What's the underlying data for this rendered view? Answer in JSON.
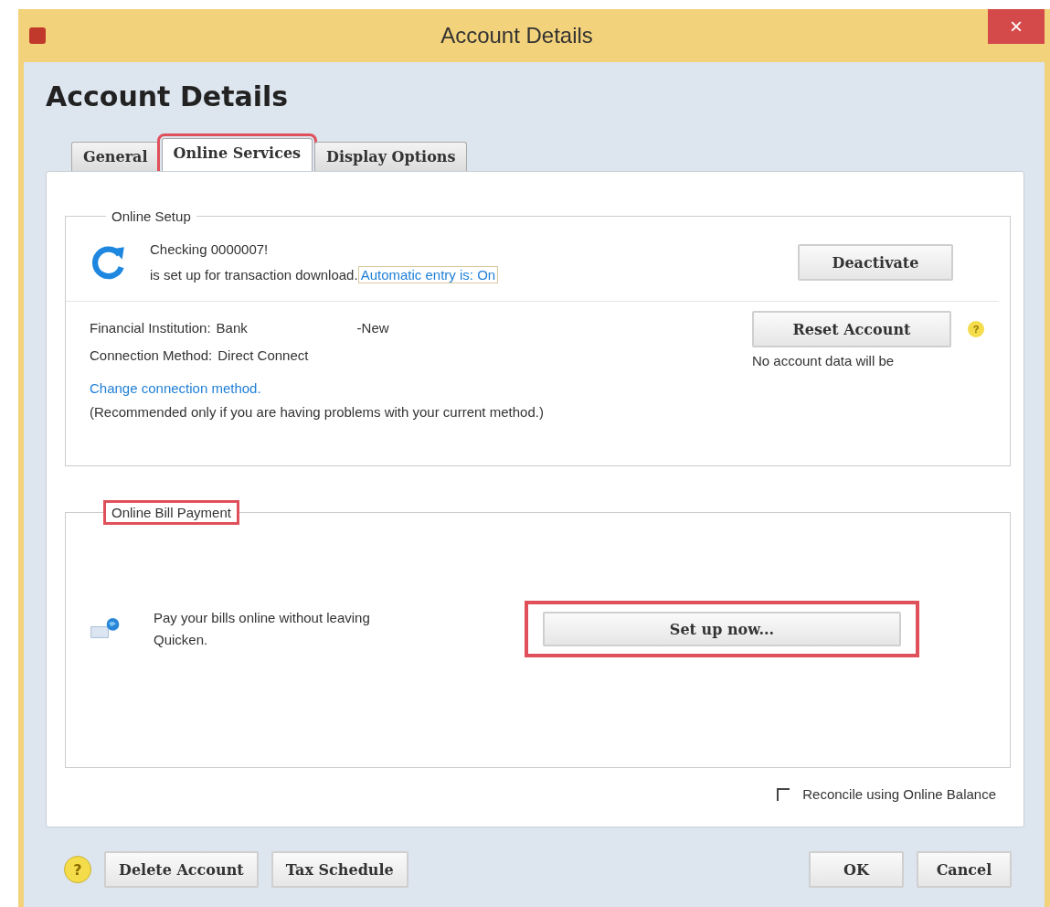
{
  "window": {
    "title": "Account Details",
    "close": "×"
  },
  "heading": "Account Details",
  "tabs": [
    {
      "label": "General",
      "selected": false,
      "highlighted": false
    },
    {
      "label": "Online Services",
      "selected": true,
      "highlighted": true
    },
    {
      "label": "Display Options",
      "selected": false,
      "highlighted": false
    }
  ],
  "online_setup": {
    "label": "Online Setup",
    "highlighted": false,
    "account": "Checking 0000007!",
    "status": "is set up for transaction download.",
    "automatic_entry_link": "Automatic entry is: On",
    "deactivate_button": "Deactivate",
    "institution_label": "Financial Institution:",
    "institution_value": "Bank",
    "institution_suffix": "-New",
    "method_label": "Connection Method:",
    "method_value": "Direct Connect",
    "reset_button": "Reset Account",
    "reset_help": "?",
    "reset_note": "No account data will be",
    "change_link": "Change connection method.",
    "change_note": "(Recommended only if you are having problems with your current method.)"
  },
  "bill_payment": {
    "label": "Online Bill Payment",
    "highlighted": true,
    "description": "Pay your bills online without leaving Quicken.",
    "setup_button": "Set up now...",
    "setup_highlighted": true
  },
  "reconcile": {
    "label": "Reconcile using Online Balance",
    "checked": false
  },
  "footer": {
    "help": "?",
    "left_buttons": [
      "Delete Account",
      "Tax Schedule"
    ],
    "right_buttons": [
      "OK",
      "Cancel"
    ]
  }
}
